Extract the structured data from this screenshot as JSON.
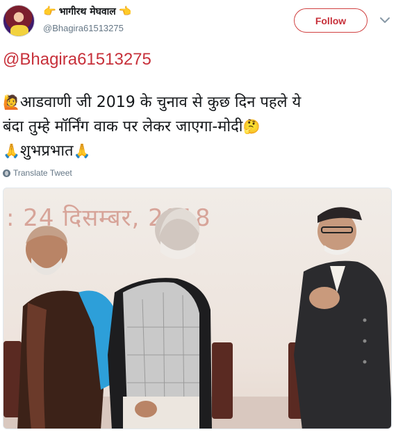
{
  "author": {
    "display_name": "भागीरथ मेघवाल",
    "handle": "@Bhagira61513275",
    "name_emoji_left": "👉",
    "name_emoji_right": "👈"
  },
  "actions": {
    "follow_label": "Follow"
  },
  "tweet": {
    "mention": "@Bhagira61513275",
    "line1_emoji": "🙋",
    "line1_text": "आडवाणी जी 2019 के चुनाव से कुछ दिन पहले ये",
    "line2_text": "बंदा तुम्हे मॉर्निंग वाक पर लेकर जाएगा-मोदी",
    "line2_emoji": "🤔",
    "line3_emoji_left": "🙏",
    "line3_text": "शुभप्रभात",
    "line3_emoji_right": "🙏",
    "translate_label": "Translate Tweet"
  },
  "photo": {
    "backdrop_text": ": 24 दिसम्बर, 2018"
  },
  "colors": {
    "accent": "#c7303a",
    "muted": "#657786",
    "text": "#14171a"
  },
  "icons": {
    "avatar": "avatar",
    "caret": "chevron-down-icon",
    "translate": "globe-icon"
  }
}
